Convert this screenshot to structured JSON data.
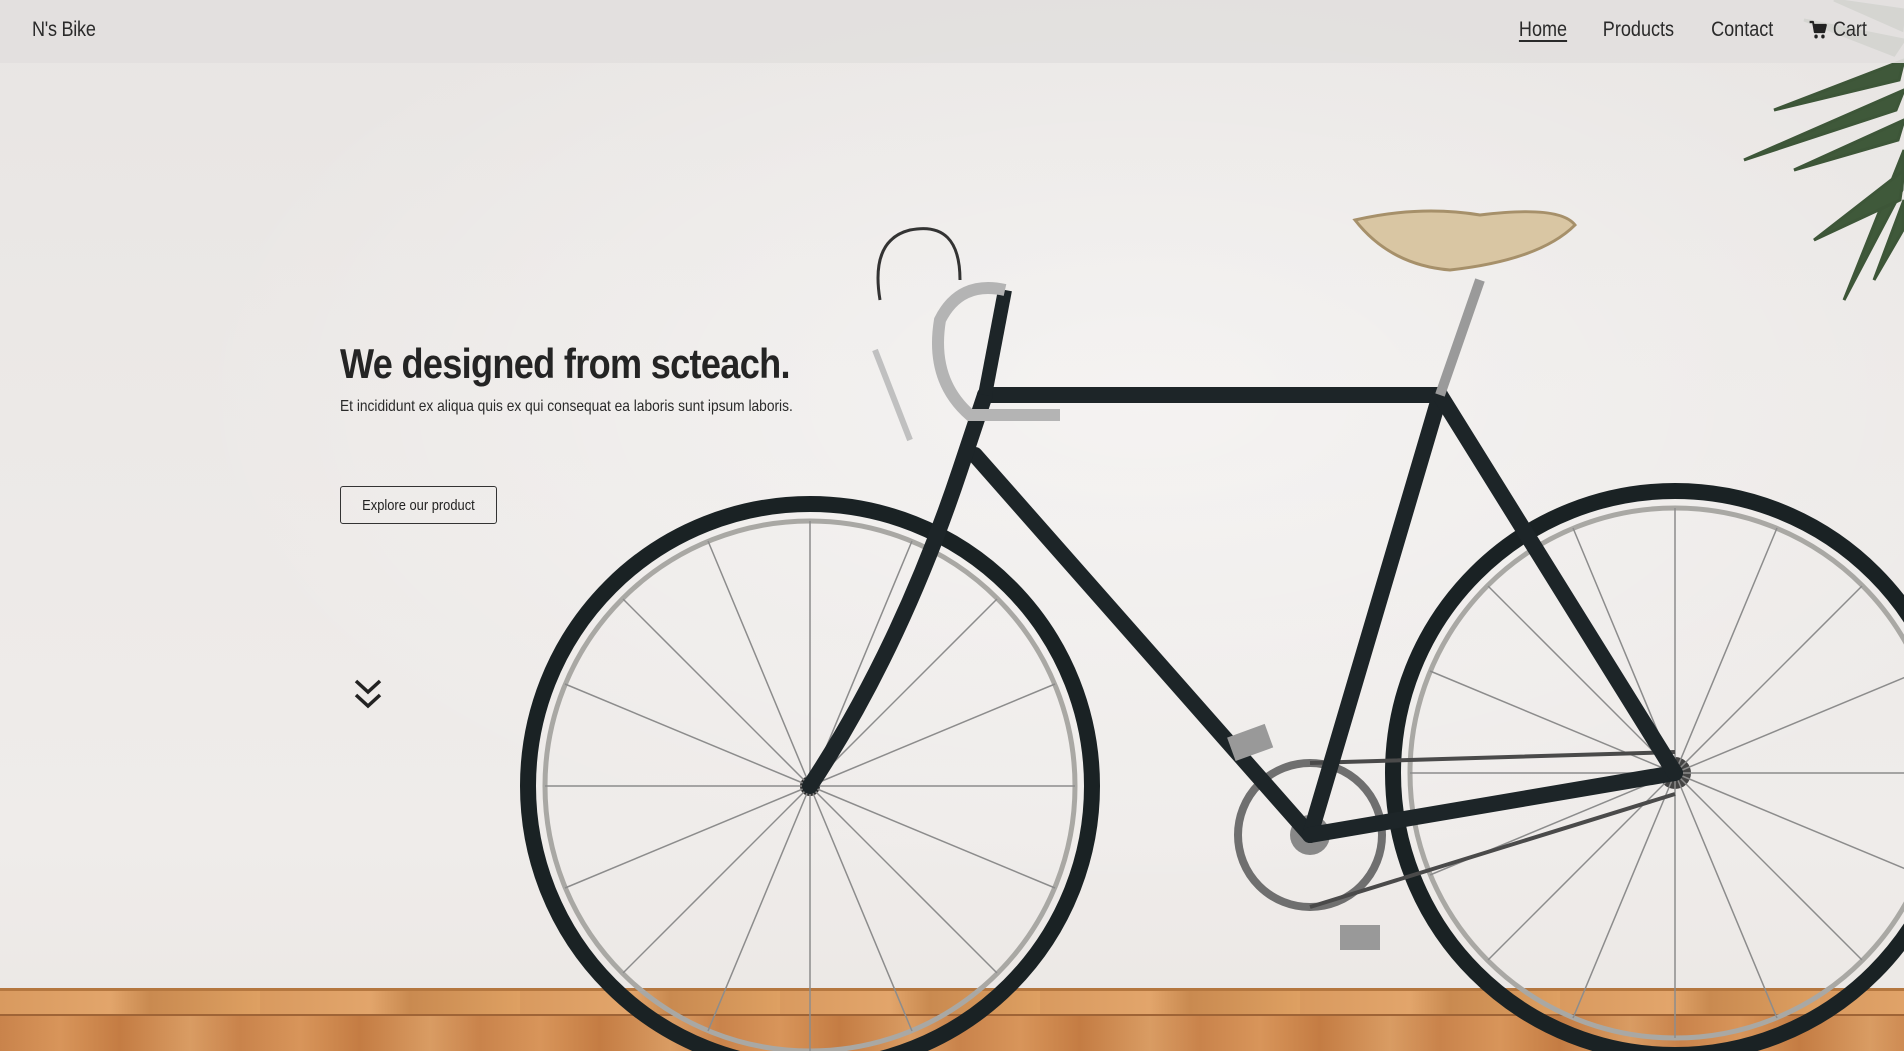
{
  "header": {
    "brand": "N's Bike",
    "nav": [
      {
        "label": "Home",
        "active": true
      },
      {
        "label": "Products",
        "active": false
      },
      {
        "label": "Contact",
        "active": false
      },
      {
        "label": "Cart",
        "active": false,
        "icon": "cart-icon"
      }
    ]
  },
  "hero": {
    "title": "We designed from scteach.",
    "subtitle": "Et incididunt ex aliqua quis ex qui consequat ea laboris sunt ipsum laboris.",
    "cta_label": "Explore our product",
    "scroll_icon": "double-chevron-down-icon"
  },
  "colors": {
    "text": "#222222",
    "header_bg": "#e2dfde",
    "wall": "#ece9e7",
    "floor": "#d4935a",
    "bike_frame": "#1d2528",
    "saddle": "#d9c6a3"
  }
}
